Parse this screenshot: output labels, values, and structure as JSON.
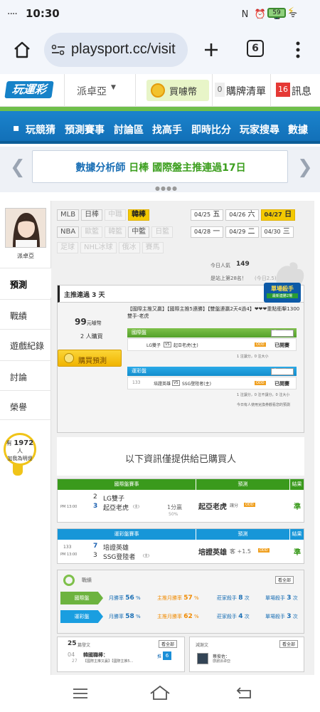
{
  "status": {
    "time": "10:30",
    "signal": "....",
    "icons": "N ⏰ 📳 ᯤ",
    "battery": "59"
  },
  "browser": {
    "url": "playsport.cc/visit",
    "tab_count": "6"
  },
  "header": {
    "logo": "玩運彩",
    "user_menu": "派卓亞",
    "coins": "買噱幣",
    "cart_count": "0",
    "cart_label": "購牌清單",
    "msg_count": "16",
    "msg_label": "訊息"
  },
  "nav": [
    "玩競猜",
    "預測賽事",
    "討論區",
    "找高手",
    "即時比分",
    "玩家搜尋",
    "數據"
  ],
  "banner": {
    "prefix": "數據分析師",
    "highlight": "日棒",
    "suffix": "國際盤主推連過17日"
  },
  "sidebar": {
    "username": "派卓亞",
    "items": [
      "預測",
      "戰績",
      "遊戲紀錄",
      "討論",
      "榮譽"
    ],
    "fans_prefix": "有",
    "fans": "1972",
    "fans_unit": "人",
    "fans_text": "加我為明燈"
  },
  "sports_row1": [
    {
      "label": "MLB",
      "state": "normal"
    },
    {
      "label": "日棒",
      "state": "normal"
    },
    {
      "label": "中職",
      "state": "dim"
    },
    {
      "label": "韓棒",
      "state": "on"
    }
  ],
  "sports_row2": [
    {
      "label": "NBA",
      "state": "normal"
    },
    {
      "label": "歐籃",
      "state": "dim"
    },
    {
      "label": "韓籃",
      "state": "dim"
    },
    {
      "label": "中籃",
      "state": "normal"
    },
    {
      "label": "日籃",
      "state": "dim"
    }
  ],
  "sports_row3": [
    {
      "label": "足球",
      "state": "dim"
    },
    {
      "label": "NHL冰球",
      "state": "dim"
    },
    {
      "label": "俄冰",
      "state": "dim"
    },
    {
      "label": "賽馬",
      "state": "dim"
    }
  ],
  "dates_row1": [
    {
      "d": "04/25",
      "w": "五",
      "state": "normal"
    },
    {
      "d": "04/26",
      "w": "六",
      "state": "normal"
    },
    {
      "d": "04/27",
      "w": "日",
      "state": "on"
    }
  ],
  "dates_row2": [
    {
      "d": "04/28",
      "w": "一",
      "state": "normal"
    },
    {
      "d": "04/29",
      "w": "二",
      "state": "normal"
    },
    {
      "d": "04/30",
      "w": "三",
      "state": "normal"
    }
  ],
  "popularity": {
    "label": "今日人氣",
    "value": "149",
    "rank_text": "是站上第28名！",
    "rank_extra": "(今日2.5)"
  },
  "killer": {
    "title": "主推連過 3 天",
    "badge": "單場殺手",
    "badge_sub": "最新連勝2場"
  },
  "purchase": {
    "price": "99",
    "price_unit": "元噱幣",
    "buyers": "2 人購買",
    "button": "購買預測"
  },
  "intro_text": "【國際主推又贏】【國際主推5連勝】【雙盤連贏2天4過4】❤❤❤重點衝擊1300雙手-老虎",
  "intl_section": {
    "title": "國際盤",
    "show_btn": "顯示讓口",
    "home": "LG雙子",
    "vs": "VS",
    "away": "起亞老虎(主)",
    "status": "已開賽",
    "note": "1 注讓分，0 注大小"
  },
  "lottery_section": {
    "title": "運彩盤",
    "show_btn": "顯示讓口",
    "num": "133",
    "home": "培證英雄",
    "vs": "VS",
    "away": "SSG登陸者(主)",
    "status": "已開賽",
    "note": "1 注讓分，0 注不讓分，0 注大小",
    "footer": "今日有人使用兌換券觀看您的預測"
  },
  "purchased_title": "以下資訊僅提供給已購買人",
  "intl_table": {
    "headers": [
      "國際盤賽事",
      "預測",
      "結果"
    ],
    "time": "PM 13:00",
    "team1_score": "2",
    "team1": "LG雙子",
    "team2_score": "3",
    "team2": "起亞老虎",
    "team2_tag": "(主)",
    "line": "1分贏",
    "line_pct": "50%",
    "pick": "起亞老虎",
    "pick_type": "讓分",
    "result": "準"
  },
  "lottery_table": {
    "headers": [
      "運彩盤賽事",
      "預測",
      "結果"
    ],
    "num": "133",
    "time": "PM 13:00",
    "team1_score": "7",
    "team1": "培證英雄",
    "team2_score": "3",
    "team2": "SSG登陸者",
    "team2_tag": "(主)",
    "pick": "培證英雄",
    "pick_type": "客 +1.5",
    "result": "準"
  },
  "record": {
    "title": "戰績",
    "more": "看全部",
    "rows": [
      {
        "label": "國際盤",
        "monthly_label": "月勝率",
        "monthly": "56",
        "main_label": "主推月勝率",
        "main": "57",
        "streak_label": "莊家殺手",
        "streak": "8",
        "single_label": "單場殺手",
        "single": "3",
        "unit": "次",
        "pct": "%"
      },
      {
        "label": "運彩盤",
        "monthly_label": "月勝率",
        "monthly": "58",
        "main_label": "主推月勝率",
        "main": "62",
        "streak_label": "莊家殺手",
        "streak": "4",
        "single_label": "單場殺手",
        "single": "3",
        "unit": "次",
        "pct": "%"
      }
    ]
  },
  "articles": {
    "count": "25",
    "label": "篇發文",
    "more": "看全部",
    "date_day": "04",
    "date_mon": "27",
    "title": "韓國職棒：",
    "subtitle": "【國際主推又贏】【國際主推5...",
    "reply_label": "推",
    "reply": "6"
  },
  "fans_box": {
    "label": "減謝文",
    "more": "看全部",
    "user": "蔡俊佐：",
    "user_sub": "感謝派卓亞"
  },
  "accent": {
    "blue": "#1682c8",
    "green": "#54a12b",
    "yellow": "#f3c900",
    "red": "#e53935"
  }
}
